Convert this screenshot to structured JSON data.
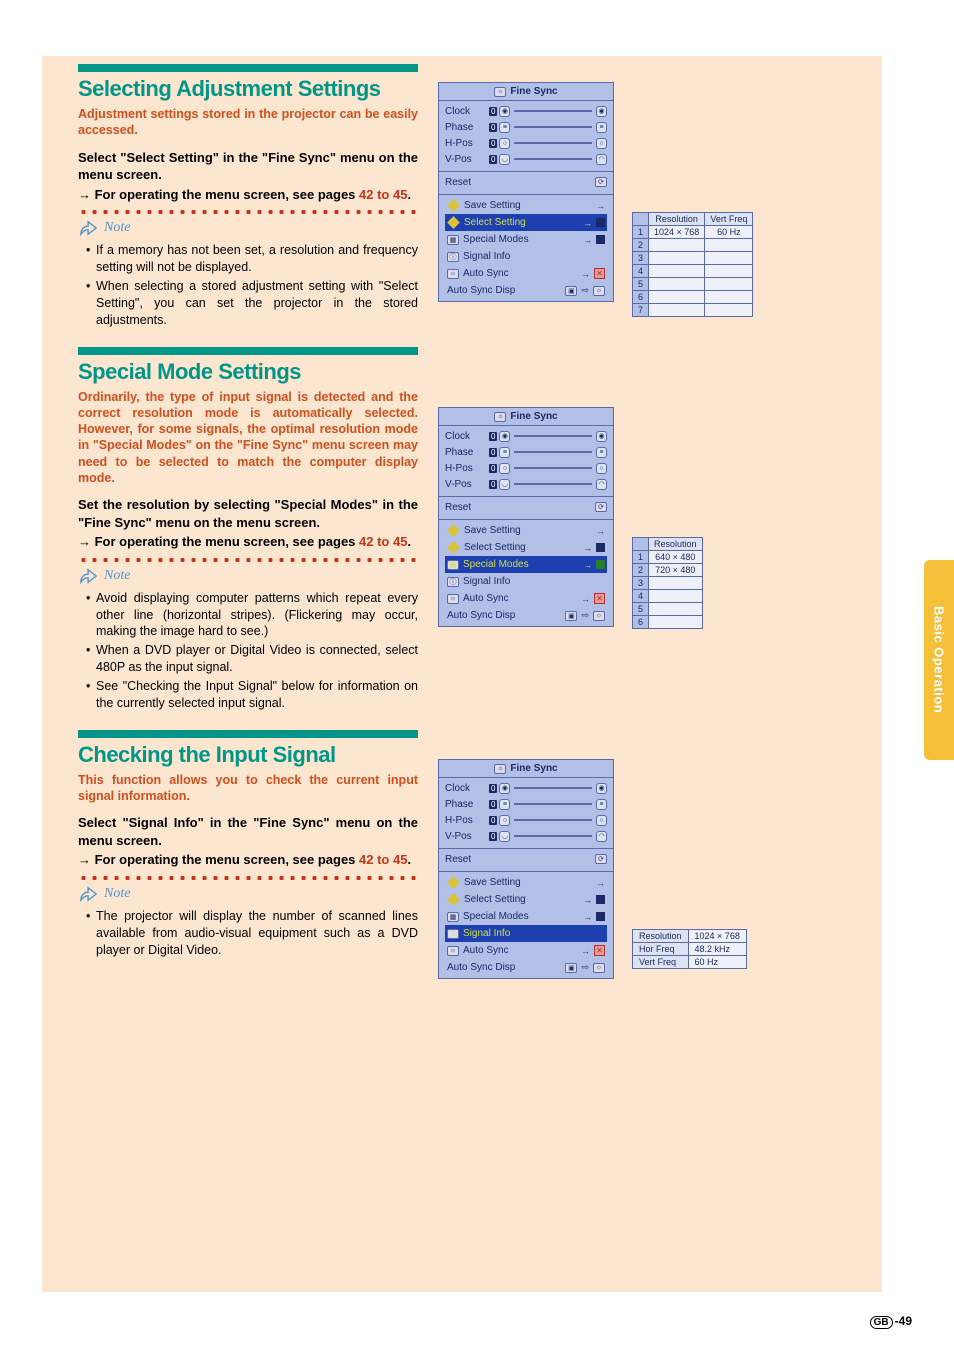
{
  "side_tab": "Basic Operation",
  "page_num_prefix": "GB",
  "page_num": "-49",
  "sections": [
    {
      "heading": "Selecting Adjustment Settings",
      "intro": "Adjustment settings stored in the projector can be easily accessed.",
      "instructA": "Select \"Select Setting\" in the \"Fine Sync\" menu on the menu screen.",
      "instructB_prefix": "→ For operating the menu screen, see pages ",
      "instructB_link": "42 to 45",
      "instructB_suffix": ".",
      "note_label": "Note",
      "notes": [
        "If a memory has not been set, a resolution and frequency setting will not be displayed.",
        "When selecting a stored adjustment setting with \"Select Setting\", you can set the projector in the stored adjustments."
      ]
    },
    {
      "heading": "Special Mode Settings",
      "intro": "Ordinarily, the type of input signal is detected and the correct resolution mode is automatically selected. However, for some signals, the optimal resolution mode in \"Special Modes\" on the \"Fine Sync\" menu screen may need to be selected to match the computer display mode.",
      "instructA": "Set the resolution by selecting \"Special Modes\" in the \"Fine Sync\" menu on the menu screen.",
      "instructB_prefix": "→ For operating the menu screen, see pages ",
      "instructB_link": "42 to 45",
      "instructB_suffix": ".",
      "note_label": "Note",
      "notes": [
        "Avoid displaying computer patterns which repeat every other line (horizontal stripes). (Flickering may occur, making the image hard to see.)",
        "When a DVD player or Digital Video is connected, select 480P as the input signal.",
        "See \"Checking the Input Signal\" below for information on the currently selected input signal."
      ]
    },
    {
      "heading": "Checking the Input Signal",
      "intro": "This function allows you to check the current input signal information.",
      "instructA": "Select \"Signal Info\" in the \"Fine Sync\" menu on the menu screen.",
      "instructB_prefix": "→ For operating the menu screen, see pages ",
      "instructB_link": "42 to 45",
      "instructB_suffix": ".",
      "note_label": "Note",
      "notes": [
        "The projector will display the number of scanned lines available from audio-visual equipment such as a DVD player or Digital Video."
      ]
    }
  ],
  "osd": {
    "title": "Fine Sync",
    "sliders": [
      "Clock",
      "Phase",
      "H-Pos",
      "V-Pos"
    ],
    "slider_val": "0",
    "reset": "Reset",
    "items": {
      "save": "Save Setting",
      "select": "Select Setting",
      "special": "Special Modes",
      "signal": "Signal Info",
      "auto": "Auto Sync",
      "autodisp": "Auto Sync Disp"
    }
  },
  "table1": {
    "h1": "Resolution",
    "h2": "Vert Freq",
    "row1_res": "1024 × 768",
    "row1_freq": "60 Hz",
    "rows": 7
  },
  "table2": {
    "h1": "Resolution",
    "row1": "640 × 480",
    "row2": "720 × 480",
    "rows": 6
  },
  "table3": {
    "r1k": "Resolution",
    "r1v": "1024 × 768",
    "r2k": "Hor Freq",
    "r2v": "48.2 kHz",
    "r3k": "Vert Freq",
    "r3v": "60 Hz"
  }
}
